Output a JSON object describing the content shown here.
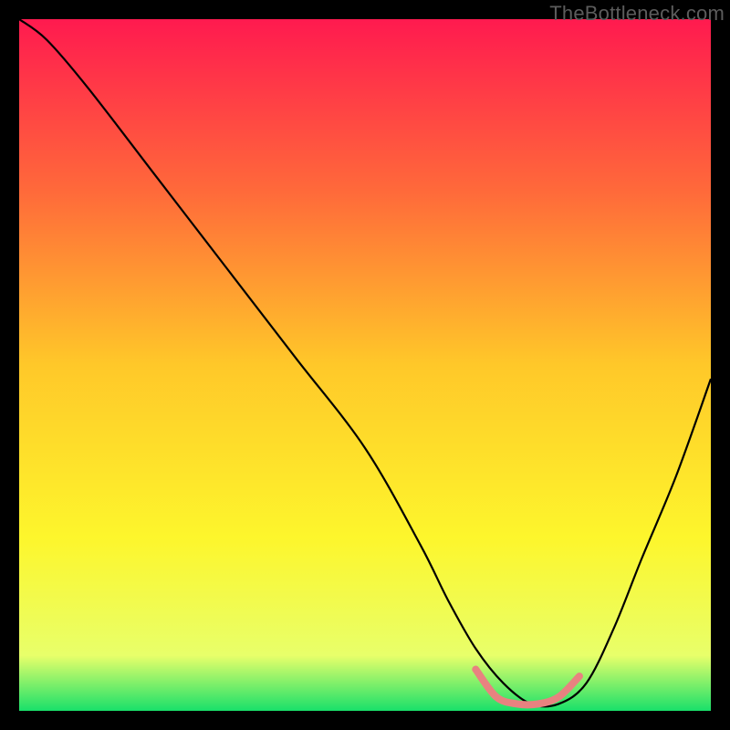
{
  "watermark": "TheBottleneck.com",
  "chart_data": {
    "type": "line",
    "title": "",
    "xlabel": "",
    "ylabel": "",
    "xlim": [
      0,
      100
    ],
    "ylim": [
      0,
      100
    ],
    "grid": false,
    "legend": false,
    "gradient_stops": [
      {
        "offset": 0.0,
        "color": "#ff1a4f"
      },
      {
        "offset": 0.25,
        "color": "#ff6a3a"
      },
      {
        "offset": 0.5,
        "color": "#ffc829"
      },
      {
        "offset": 0.75,
        "color": "#fdf62c"
      },
      {
        "offset": 0.92,
        "color": "#e8ff6a"
      },
      {
        "offset": 1.0,
        "color": "#19e06a"
      }
    ],
    "curve": {
      "x": [
        0,
        4,
        10,
        20,
        30,
        40,
        50,
        58,
        62,
        66,
        70,
        74,
        78,
        82,
        86,
        90,
        95,
        100
      ],
      "values": [
        100,
        97,
        90,
        77,
        64,
        51,
        38,
        24,
        16,
        9,
        4,
        1,
        1,
        4,
        12,
        22,
        34,
        48
      ]
    },
    "highlight_band": {
      "x": [
        66,
        69,
        72,
        75,
        78,
        81
      ],
      "values": [
        6,
        2,
        1,
        1,
        2,
        5
      ],
      "color": "#e88280",
      "thickness": 8
    }
  }
}
